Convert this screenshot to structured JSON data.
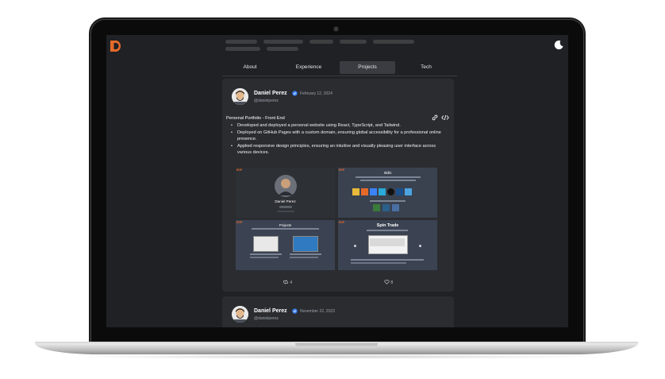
{
  "tabs": [
    {
      "label": "About",
      "active": false
    },
    {
      "label": "Experience",
      "active": false
    },
    {
      "label": "Projects",
      "active": true
    },
    {
      "label": "Tech",
      "active": false
    }
  ],
  "post1": {
    "name": "Daniel Perez",
    "handle": "@danielperez",
    "date": "February 12, 2024",
    "title": "Personal Portfolio - Front End",
    "bullets": [
      "Developed and deployed a personal website using React, TypeScript, and Tailwind.",
      "Deployed on GitHub Pages with a custom domain, ensuring global accessibility for a professional online presence.",
      "Applied responsive design principles, ensuring an intuitive and visually pleasing user interface across various devices."
    ],
    "thumbnails": [
      {
        "badge": "EDP",
        "title": "Daniel Perez"
      },
      {
        "badge": "EDP",
        "title": "Skills"
      },
      {
        "badge": "EDP",
        "title": "Projects"
      },
      {
        "badge": "EDP",
        "title": "Spin Trade"
      }
    ],
    "reposts": "4",
    "likes": "8"
  },
  "post2": {
    "name": "Daniel Perez",
    "handle": "@danielperez",
    "date": "November 22, 2023"
  },
  "colors": {
    "accent": "#e56a2a",
    "verified": "#3b82f6",
    "screen_bg": "#1f2125",
    "card_bg": "#2a2c30"
  }
}
